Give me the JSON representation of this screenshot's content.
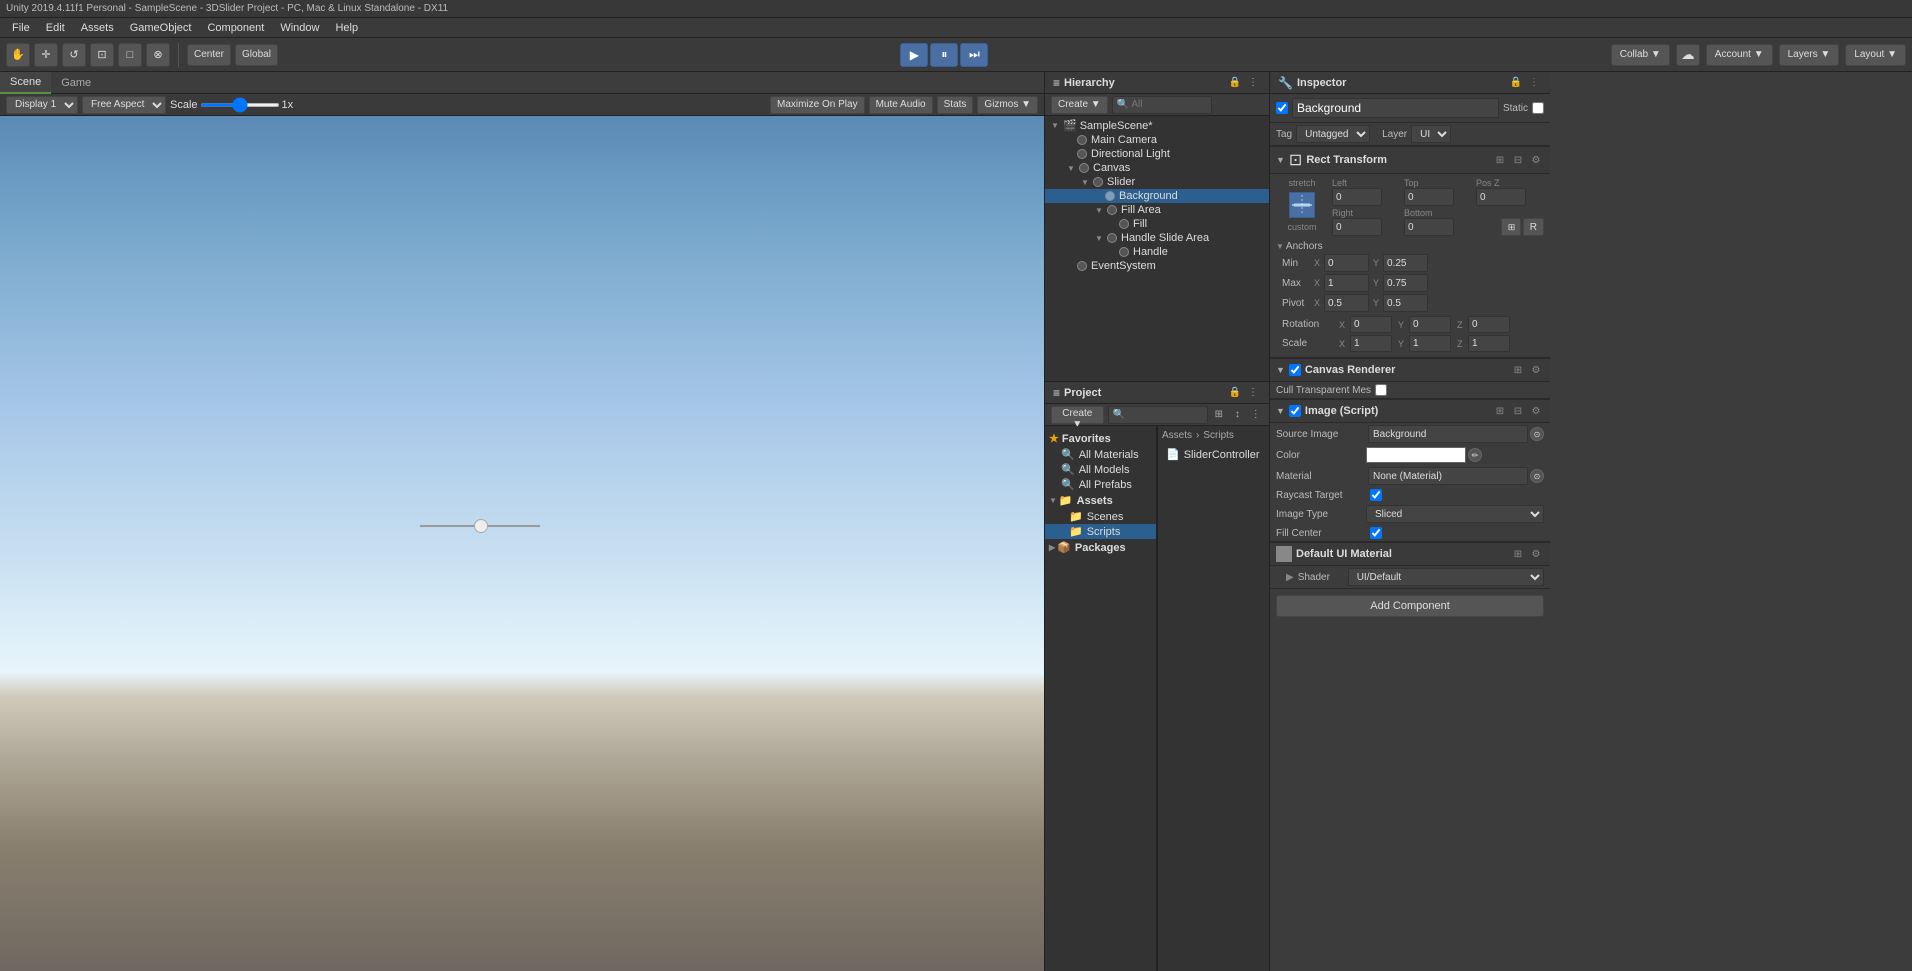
{
  "titlebar": {
    "text": "Unity 2019.4.11f1 Personal - SampleScene - 3DSlider Project - PC, Mac & Linux Standalone - DX11"
  },
  "menubar": {
    "items": [
      "File",
      "Edit",
      "Assets",
      "GameObject",
      "Component",
      "Window",
      "Help"
    ]
  },
  "toolbar": {
    "tools": [
      "⊕",
      "+",
      "↺",
      "⊡",
      "□",
      "⊗"
    ],
    "center_label": "Center",
    "global_label": "Global",
    "play_label": "▶",
    "pause_label": "⏸",
    "step_label": "⏭",
    "collab_label": "Collab ▼",
    "cloud_label": "☁",
    "account_label": "Account ▼",
    "layers_label": "Layers ▼",
    "layout_label": "Layout ▼"
  },
  "tabs": {
    "scene": "Scene",
    "game": "Game"
  },
  "viewport_toolbar": {
    "display_label": "Display 1",
    "aspect_label": "Free Aspect",
    "scale_label": "Scale",
    "scale_value": "1x",
    "maximize_label": "Maximize On Play",
    "mute_label": "Mute Audio",
    "stats_label": "Stats",
    "gizmos_label": "Gizmos ▼"
  },
  "hierarchy": {
    "title": "Hierarchy",
    "create_label": "Create ▼",
    "search_placeholder": "🔍 All",
    "scene_name": "SampleScene*",
    "items": [
      {
        "label": "Main Camera",
        "indent": 1,
        "toggle": "",
        "has_toggle": false,
        "icon": "camera"
      },
      {
        "label": "Directional Light",
        "indent": 1,
        "toggle": "",
        "has_toggle": false,
        "icon": "light"
      },
      {
        "label": "Canvas",
        "indent": 1,
        "toggle": "▼",
        "has_toggle": true,
        "icon": "canvas",
        "expanded": true
      },
      {
        "label": "Slider",
        "indent": 2,
        "toggle": "▼",
        "has_toggle": true,
        "icon": "slider",
        "expanded": true
      },
      {
        "label": "Background",
        "indent": 3,
        "toggle": "",
        "has_toggle": false,
        "icon": "image",
        "selected": true
      },
      {
        "label": "Fill Area",
        "indent": 3,
        "toggle": "▼",
        "has_toggle": true,
        "icon": "area",
        "expanded": true
      },
      {
        "label": "Fill",
        "indent": 4,
        "toggle": "",
        "has_toggle": false,
        "icon": "fill"
      },
      {
        "label": "Handle Slide Area",
        "indent": 3,
        "toggle": "▼",
        "has_toggle": true,
        "icon": "area",
        "expanded": true
      },
      {
        "label": "Handle",
        "indent": 4,
        "toggle": "",
        "has_toggle": false,
        "icon": "handle"
      },
      {
        "label": "EventSystem",
        "indent": 1,
        "toggle": "",
        "has_toggle": false,
        "icon": "event"
      }
    ]
  },
  "project": {
    "title": "Project",
    "create_label": "Create ▼",
    "search_placeholder": "🔍",
    "favorites_label": "Favorites",
    "favorites_items": [
      "All Materials",
      "All Models",
      "All Prefabs"
    ],
    "assets_label": "Assets",
    "assets_items": [
      "Scenes",
      "Scripts"
    ],
    "packages_label": "Packages",
    "right_panel": {
      "label": "Assets",
      "breadcrumb": "Scripts",
      "items": [
        "SliderController"
      ]
    }
  },
  "inspector": {
    "title": "Inspector",
    "object_name": "Background",
    "static_label": "Static",
    "static_checked": false,
    "tag_label": "Tag",
    "tag_value": "Untagged",
    "layer_label": "Layer",
    "layer_value": "UI",
    "rect_transform": {
      "title": "Rect Transform",
      "stretch_label": "stretch",
      "custom_label": "custom",
      "left_label": "Left",
      "top_label": "Top",
      "pos_z_label": "Pos Z",
      "left_value": "0",
      "top_value": "0",
      "pos_z_value": "0",
      "right_label": "Right",
      "bottom_label": "Bottom",
      "right_value": "0",
      "bottom_value": "0",
      "r_label": "R",
      "anchors_label": "Anchors",
      "min_label": "Min",
      "min_x": "0",
      "min_y": "0.25",
      "max_label": "Max",
      "max_x": "1",
      "max_y": "0.75",
      "pivot_label": "Pivot",
      "pivot_x": "0.5",
      "pivot_y": "0.5",
      "rotation_label": "Rotation",
      "rot_x": "0",
      "rot_y": "0",
      "rot_z": "0",
      "scale_label": "Scale",
      "scale_x": "1",
      "scale_y": "1",
      "scale_z": "1"
    },
    "canvas_renderer": {
      "title": "Canvas Renderer",
      "cull_label": "Cull Transparent Mes",
      "cull_checked": false
    },
    "image_script": {
      "title": "Image (Script)",
      "source_image_label": "Source Image",
      "source_image_value": "Background",
      "color_label": "Color",
      "color_value": "#FFFFFF",
      "material_label": "Material",
      "material_value": "None (Material)",
      "raycast_label": "Raycast Target",
      "raycast_checked": true,
      "image_type_label": "Image Type",
      "image_type_value": "Sliced",
      "fill_center_label": "Fill Center",
      "fill_center_checked": true
    },
    "default_material": {
      "title": "Default UI Material",
      "shader_label": "Shader",
      "shader_value": "UI/Default"
    },
    "add_component_label": "Add Component"
  }
}
